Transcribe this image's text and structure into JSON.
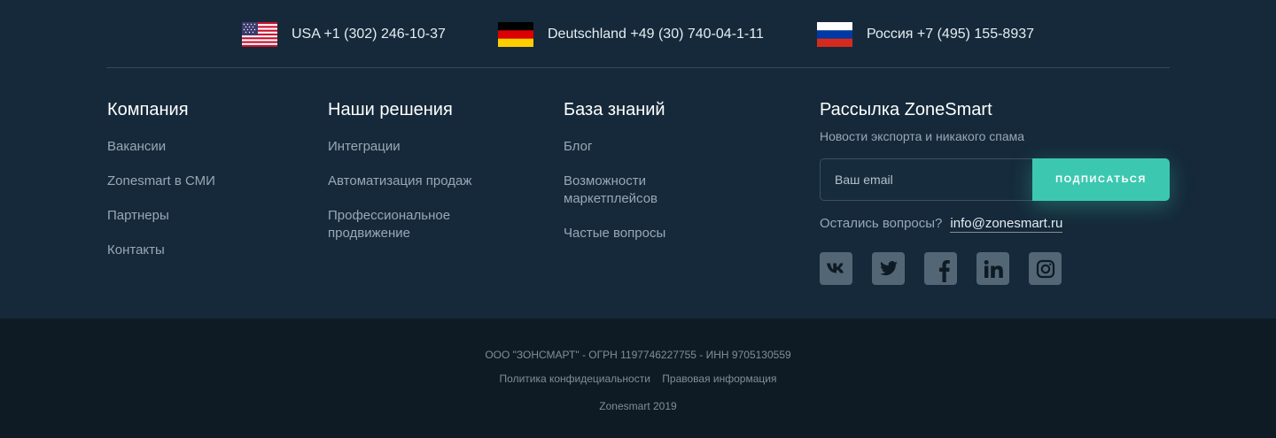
{
  "phones": [
    {
      "flag": "us-flag-icon",
      "text": "USA +1 (302) 246-10-37"
    },
    {
      "flag": "de-flag-icon",
      "text": "Deutschland +49 (30) 740-04-1-11"
    },
    {
      "flag": "ru-flag-icon",
      "text": "Россия +7 (495) 155-8937"
    }
  ],
  "company": {
    "title": "Компания",
    "items": [
      "Вакансии",
      "Zonesmart в СМИ",
      "Партнеры",
      "Контакты"
    ]
  },
  "solutions": {
    "title": "Наши решения",
    "items": [
      "Интеграции",
      "Автоматизация продаж",
      "Профессиональное продвижение"
    ]
  },
  "knowledge": {
    "title": "База знаний",
    "items": [
      "Блог",
      "Возможности маркетплейсов",
      "Частые вопросы"
    ]
  },
  "newsletter": {
    "title": "Рассылка ZoneSmart",
    "subtitle": "Новости экспорта и никакого спама",
    "email_placeholder": "Ваш email",
    "button": "ПОДПИСАТЬСЯ",
    "question": "Остались вопросы?",
    "email": "info@zonesmart.ru",
    "socials": [
      "vk-icon",
      "twitter-icon",
      "facebook-icon",
      "linkedin-icon",
      "instagram-icon"
    ]
  },
  "footer": {
    "legal": "ООО \"ЗОНСМАРТ\" - ОГРН 1197746227755 - ИНН 9705130559",
    "privacy": "Политика конфидециальности",
    "legal_info": "Правовая информация",
    "copyright": "Zonesmart 2019"
  },
  "colors": {
    "top_bg": "#15293a",
    "bottom_bg": "#0f1b24",
    "accent": "#3cc8b0",
    "social_bg": "#536675"
  }
}
